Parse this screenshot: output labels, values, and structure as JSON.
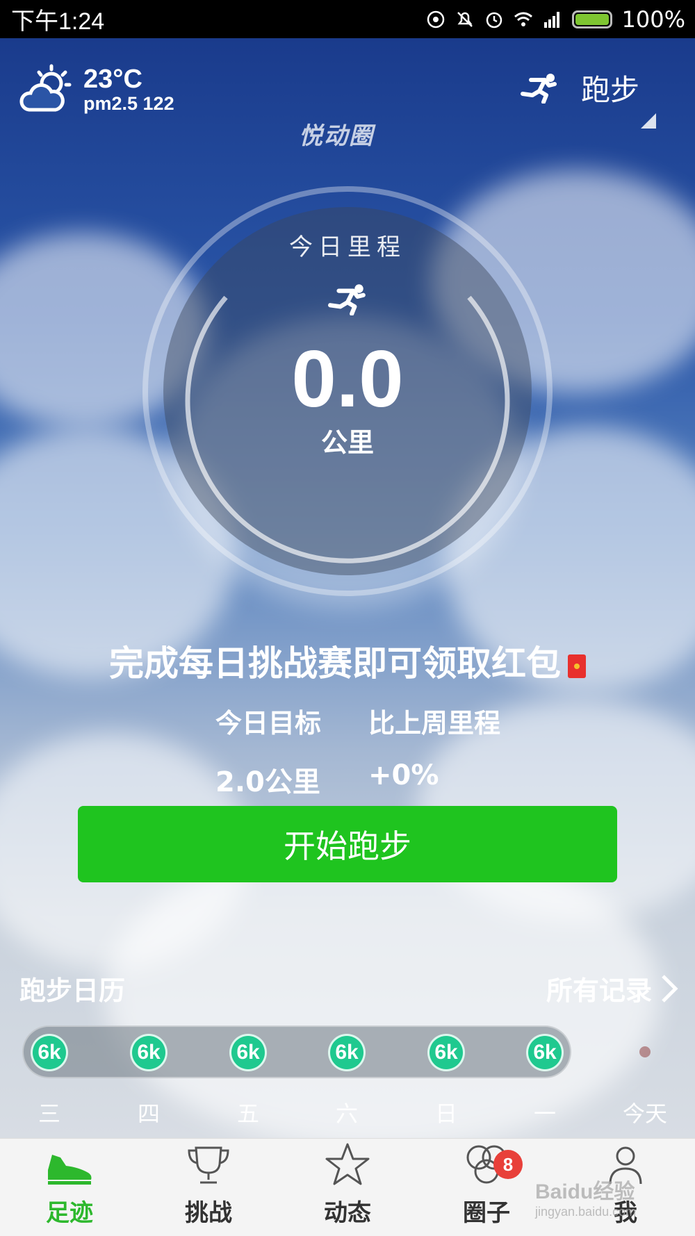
{
  "status_bar": {
    "time": "下午1:24",
    "battery": "100%"
  },
  "header": {
    "temperature": "23°C",
    "pm25": "pm2.5 122",
    "sport_label": "跑步",
    "logo": "悦动圈"
  },
  "ring": {
    "label": "今日里程",
    "value": "0.0",
    "unit": "公里"
  },
  "promo": {
    "text": "完成每日挑战赛即可领取红包"
  },
  "stats": {
    "goal_label": "今日目标",
    "compare_label": "比上周里程",
    "goal_value": "2.0公里",
    "compare_value": "+0%"
  },
  "start_button": {
    "label": "开始跑步"
  },
  "calendar": {
    "title": "跑步日历",
    "all_records": "所有记录",
    "days": [
      {
        "badge": "6k",
        "label": "三"
      },
      {
        "badge": "6k",
        "label": "四"
      },
      {
        "badge": "6k",
        "label": "五"
      },
      {
        "badge": "6k",
        "label": "六"
      },
      {
        "badge": "6k",
        "label": "日"
      },
      {
        "badge": "6k",
        "label": "一"
      },
      {
        "badge": "",
        "label": "今天"
      }
    ]
  },
  "tabs": [
    {
      "label": "足迹",
      "icon": "shoe-icon",
      "active": true
    },
    {
      "label": "挑战",
      "icon": "trophy-icon"
    },
    {
      "label": "动态",
      "icon": "star-icon"
    },
    {
      "label": "圈子",
      "icon": "rings-icon",
      "badge": "8"
    },
    {
      "label": "我",
      "icon": "person-icon"
    }
  ],
  "watermark": {
    "main": "Baidu经验",
    "sub": "jingyan.baidu.com"
  },
  "colors": {
    "accent": "#1fc41f",
    "badge": "#1fc98f",
    "tab_active": "#2db82d",
    "notify": "#e8403a"
  }
}
